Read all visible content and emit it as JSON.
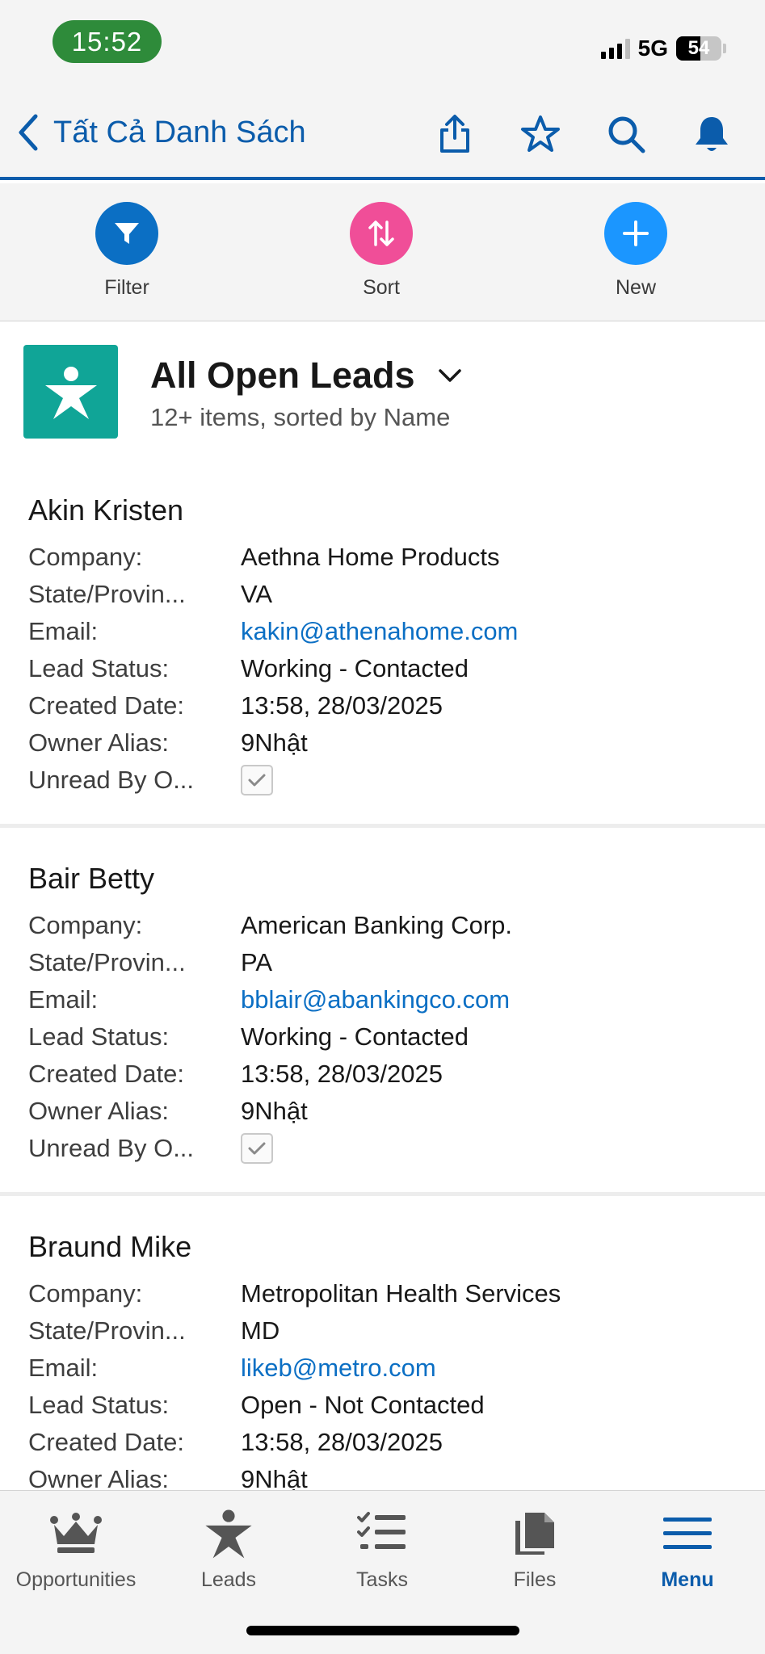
{
  "status_bar": {
    "time": "15:52",
    "network": "5G",
    "battery": "54",
    "battery_level": 0.54
  },
  "nav": {
    "back_title": "Tất Cả Danh Sách",
    "icons": [
      "share-icon",
      "star-icon",
      "search-icon",
      "bell-icon"
    ]
  },
  "actions": {
    "filter": {
      "label": "Filter",
      "color": "#0b6fc4"
    },
    "sort": {
      "label": "Sort",
      "color": "#f04e98"
    },
    "new": {
      "label": "New",
      "color": "#1b96ff"
    }
  },
  "list": {
    "title": "All Open Leads",
    "subtitle": "12+ items, sorted by Name",
    "icon_color": "#10a597"
  },
  "field_labels": {
    "company": "Company:",
    "state": "State/Provin...",
    "email": "Email:",
    "lead_status": "Lead Status:",
    "created_date": "Created Date:",
    "owner_alias": "Owner Alias:",
    "unread": "Unread By O..."
  },
  "records": [
    {
      "name": "Akin Kristen",
      "company": "Aethna Home Products",
      "state": "VA",
      "email": "kakin@athenahome.com",
      "lead_status": "Working - Contacted",
      "created_date": "13:58, 28/03/2025",
      "owner_alias": "9Nhật",
      "unread": true
    },
    {
      "name": "Bair Betty",
      "company": "American Banking Corp.",
      "state": "PA",
      "email": "bblair@abankingco.com",
      "lead_status": "Working - Contacted",
      "created_date": "13:58, 28/03/2025",
      "owner_alias": "9Nhật",
      "unread": true
    },
    {
      "name": "Braund Mike",
      "company": "Metropolitan Health Services",
      "state": "MD",
      "email": "likeb@metro.com",
      "lead_status": "Open - Not Contacted",
      "created_date": "13:58, 28/03/2025",
      "owner_alias": "9Nhật"
    }
  ],
  "tabbar": {
    "opportunities": "Opportunities",
    "leads": "Leads",
    "tasks": "Tasks",
    "files": "Files",
    "menu": "Menu",
    "active": "menu",
    "active_color": "#0b5cab"
  }
}
